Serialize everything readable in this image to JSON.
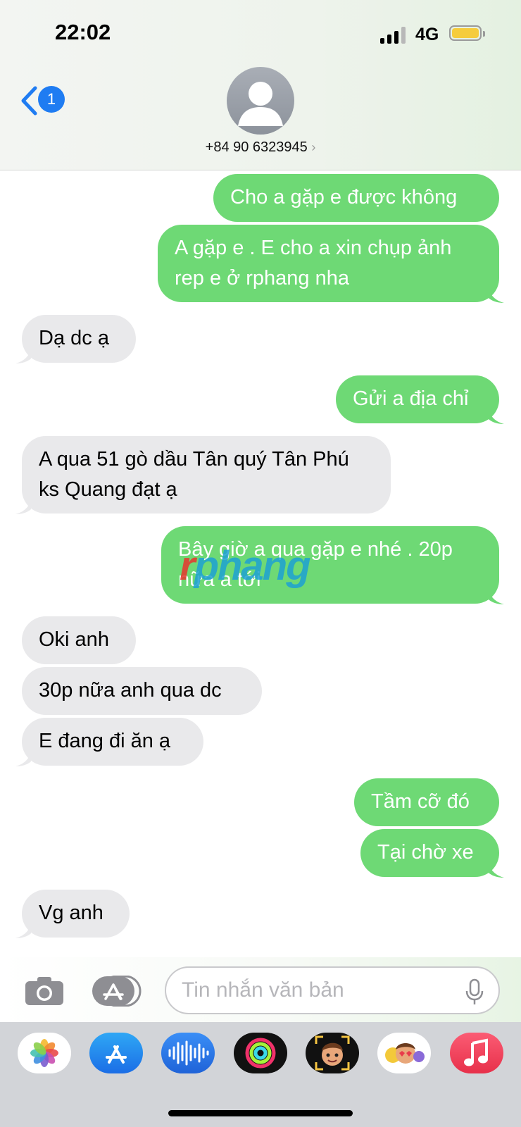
{
  "status_bar": {
    "time": "22:02",
    "network": "4G"
  },
  "header": {
    "back_badge": "1",
    "contact": "+84 90 6323945"
  },
  "messages": [
    {
      "dir": "sent",
      "text": "Cho a gặp e được không"
    },
    {
      "dir": "sent",
      "text": "A gặp e . E cho a xin chụp ảnh\nrep e ở rphang nha"
    },
    {
      "dir": "recv",
      "text": "Dạ dc ạ"
    },
    {
      "dir": "sent",
      "text": "Gửi a địa chỉ"
    },
    {
      "dir": "recv",
      "text": "A qua 51 gò dầu Tân quý Tân Phú\nks Quang đạt ạ"
    },
    {
      "dir": "sent",
      "text": "Bây giờ a qua gặp e nhé . 20p\nnữa a tới"
    },
    {
      "dir": "recv",
      "text": "Oki anh"
    },
    {
      "dir": "recv",
      "text": "30p nữa anh qua dc"
    },
    {
      "dir": "recv",
      "text": "E đang đi ăn ạ"
    },
    {
      "dir": "sent",
      "text": "Tầm cỡ đó"
    },
    {
      "dir": "sent",
      "text": "Tại chờ xe"
    },
    {
      "dir": "recv",
      "text": "Vg anh"
    }
  ],
  "watermark": {
    "first": "r",
    "rest": "phang"
  },
  "input": {
    "placeholder": "Tin nhắn văn bản"
  },
  "app_drawer": [
    "photos-icon",
    "app-store-icon",
    "audio-message-icon",
    "activity-icon",
    "memoji-icon",
    "memoji-stickers-icon",
    "music-icon"
  ],
  "colors": {
    "sent": "#6ed975",
    "received": "#e9e9eb",
    "accent": "#1f7cf2"
  }
}
